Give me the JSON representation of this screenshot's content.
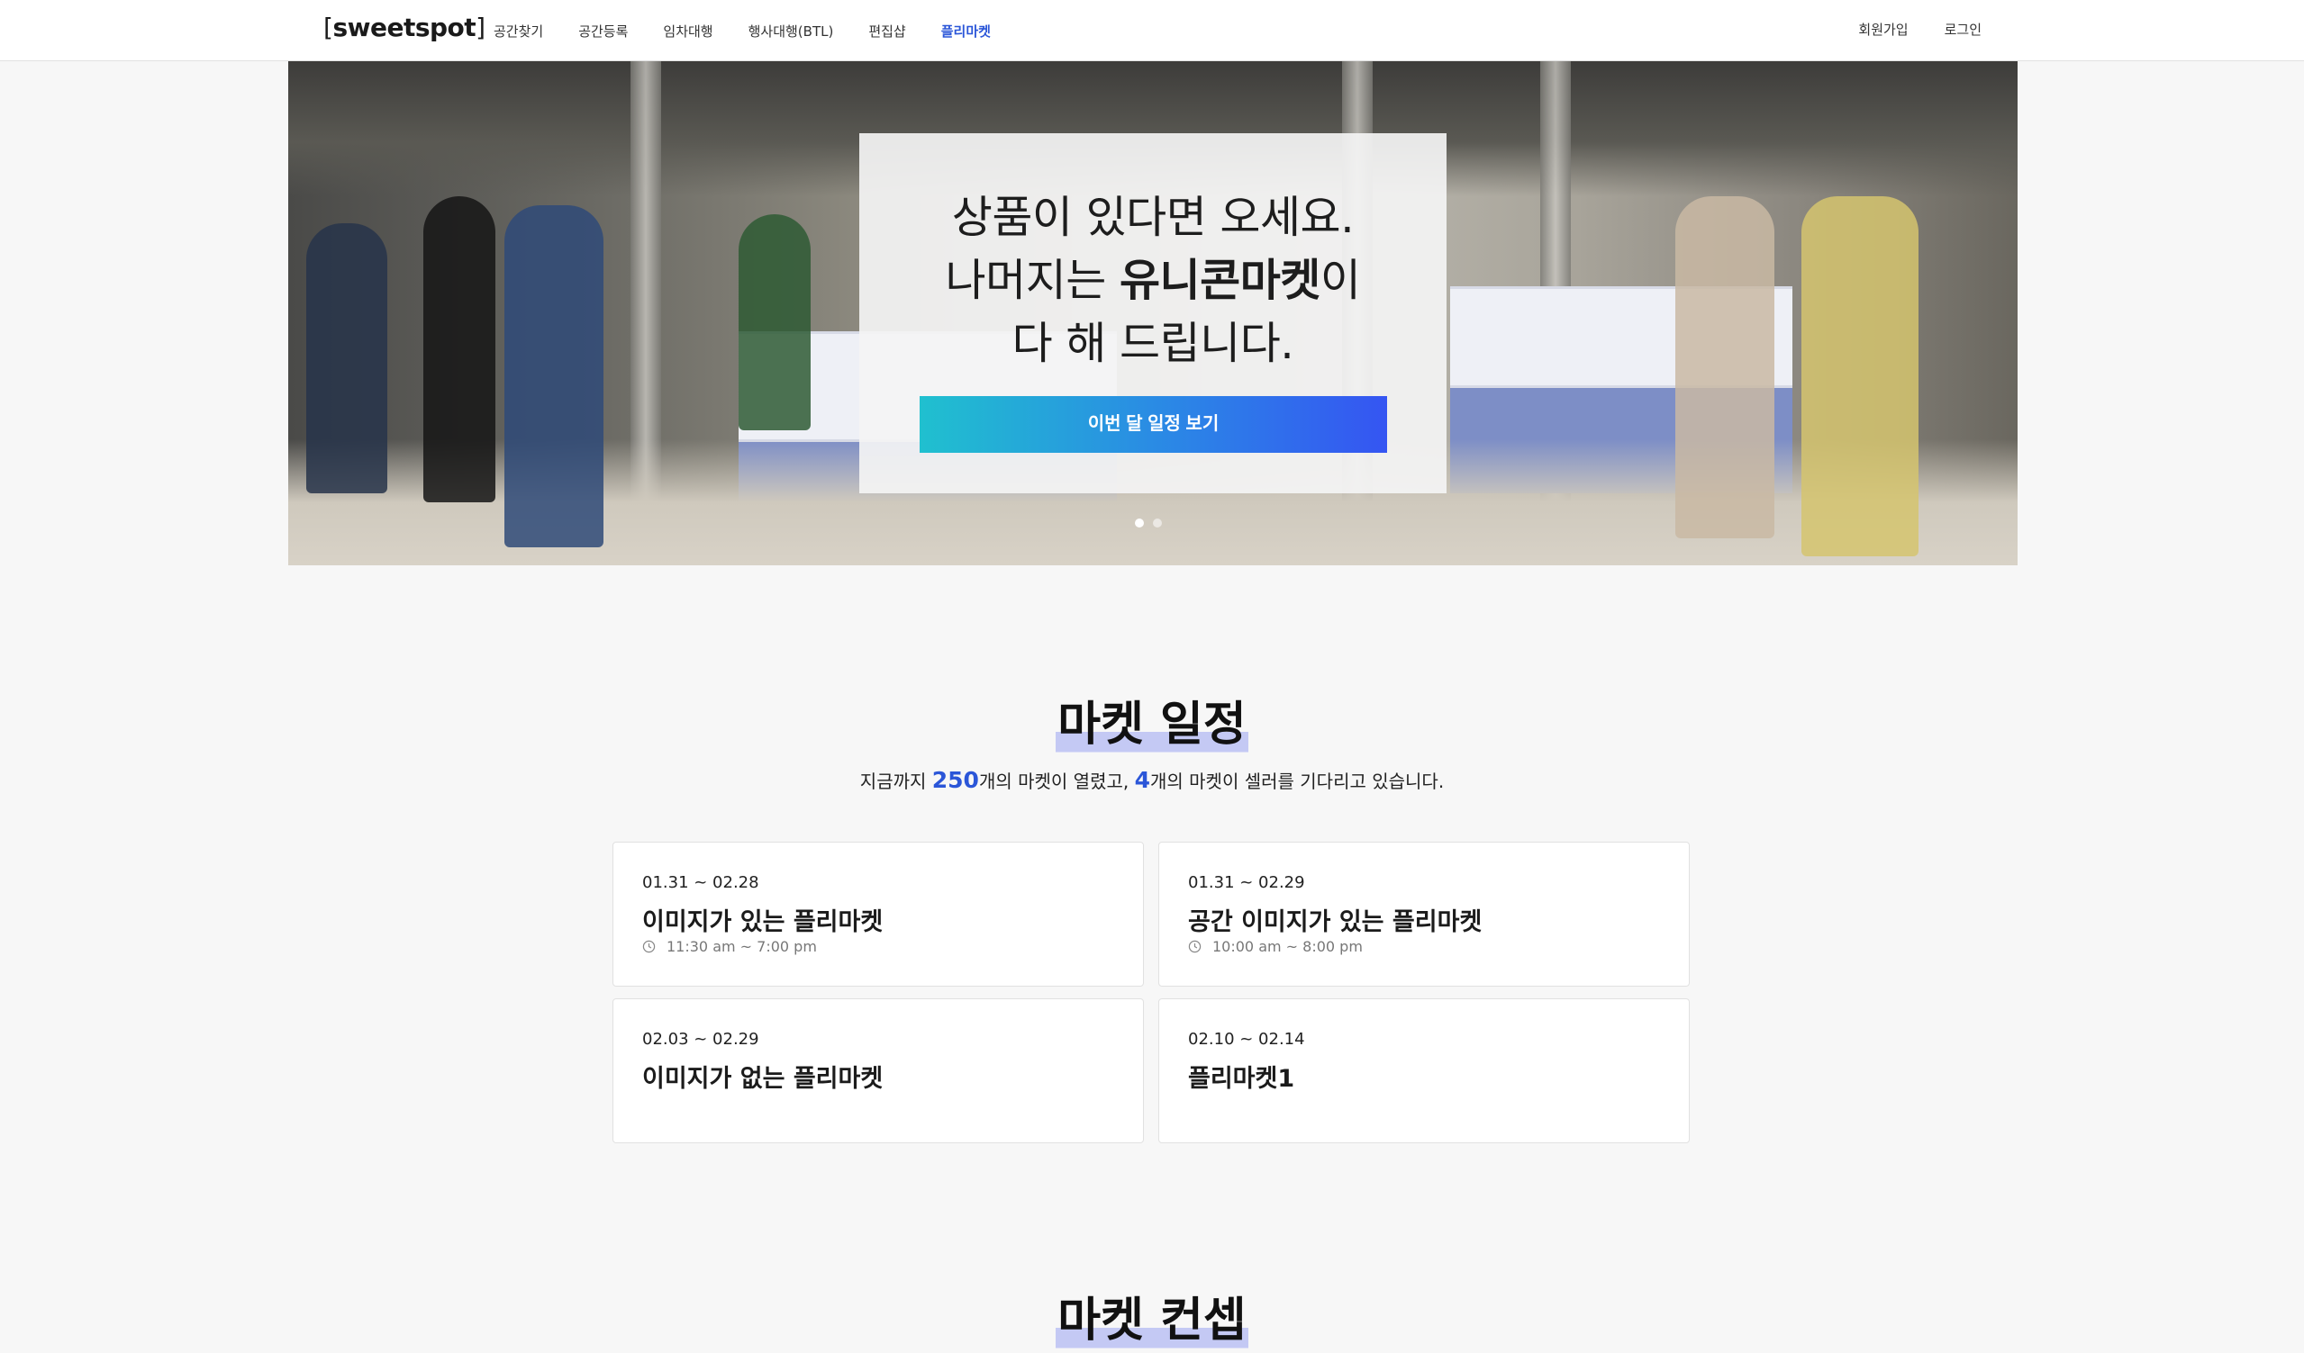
{
  "header": {
    "logo_text": "sweetspot",
    "nav": [
      "공간찾기",
      "공간등록",
      "임차대행",
      "행사대행(BTL)",
      "편집샵",
      "플리마켓"
    ],
    "active_nav": "플리마켓",
    "auth": [
      "회원가입",
      "로그인"
    ],
    "accent_color": "#2b56d8"
  },
  "hero": {
    "line1": "상품이 있다면 오세요.",
    "line2_prefix": "나머지는 ",
    "line2_bold": "유니콘마켓",
    "line2_suffix": "이",
    "line3": "다 해 드립니다.",
    "cta_label": "이번 달 일정 보기",
    "cta_gradient": [
      "#20c0cf",
      "#3555f2"
    ],
    "slides_total": 2,
    "slide_active": 1
  },
  "schedule": {
    "title": "마켓 일정",
    "summary_prefix": "지금까지 ",
    "markets_opened": "250",
    "summary_middle": "개의 마켓이 열렸고, ",
    "markets_waiting": "4",
    "summary_suffix": "개의 마켓이 셀러를 기다리고 있습니다.",
    "cards": [
      {
        "date": "01.31 ~ 02.28",
        "title": "이미지가 있는 플리마켓",
        "time": "11:30 am ~ 7:00 pm"
      },
      {
        "date": "01.31 ~ 02.29",
        "title": "공간 이미지가 있는 플리마켓",
        "time": "10:00 am ~ 8:00 pm"
      },
      {
        "date": "02.03 ~ 02.29",
        "title": "이미지가 없는 플리마켓",
        "time": ""
      },
      {
        "date": "02.10 ~ 02.14",
        "title": "플리마켓1",
        "time": ""
      }
    ]
  },
  "concept": {
    "title": "마켓 컨셉"
  },
  "icons": [
    "clock-icon"
  ]
}
